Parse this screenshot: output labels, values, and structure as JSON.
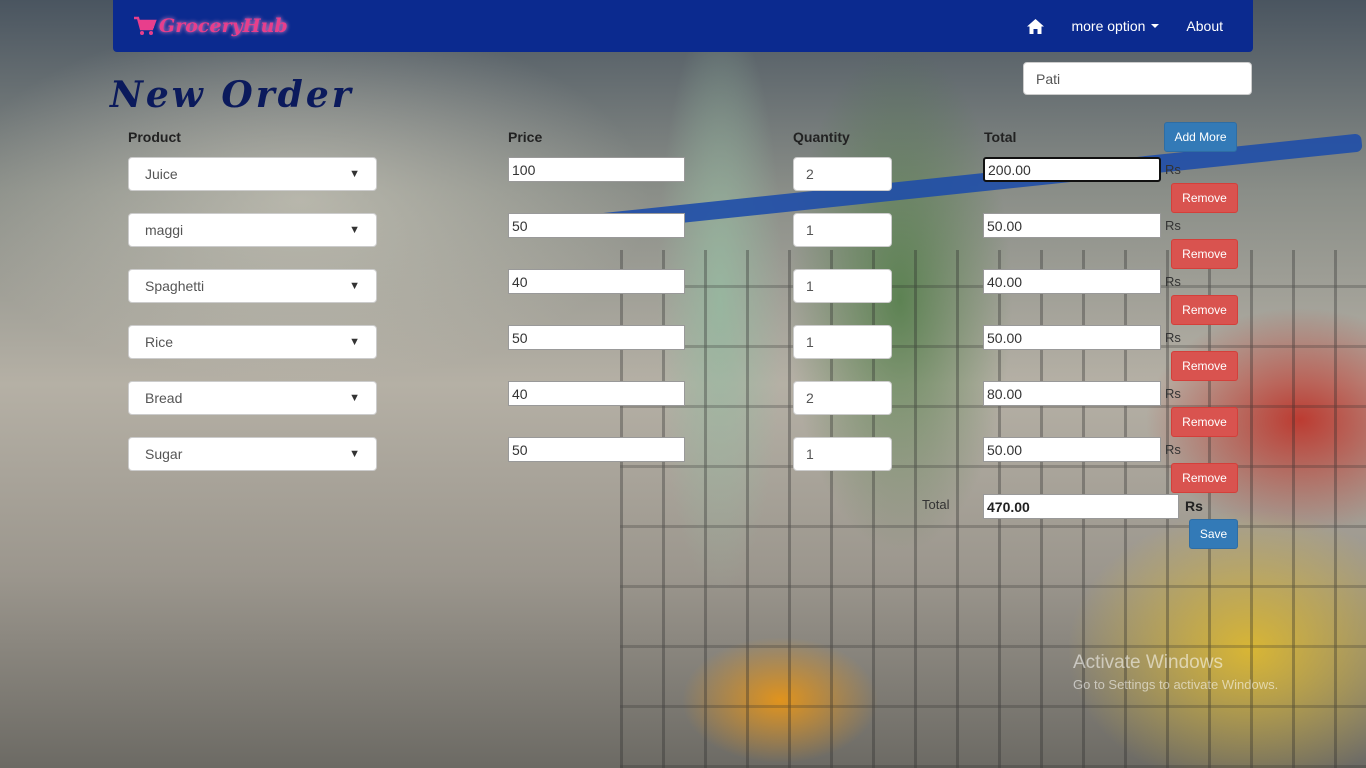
{
  "brand": {
    "name": "GroceryHub",
    "icon": "shopping-cart-icon"
  },
  "nav": {
    "home_icon": "home-icon",
    "more_option": "more option",
    "about": "About"
  },
  "search": {
    "value": "Pati"
  },
  "page": {
    "title": "New Order"
  },
  "columns": {
    "product": "Product",
    "price": "Price",
    "quantity": "Quantity",
    "total": "Total"
  },
  "buttons": {
    "add_more": "Add More",
    "remove": "Remove",
    "save": "Save"
  },
  "currency": "Rs",
  "rows": [
    {
      "product": "Juice",
      "price": "100",
      "quantity": "2",
      "total": "200.00"
    },
    {
      "product": "maggi",
      "price": "50",
      "quantity": "1",
      "total": "50.00"
    },
    {
      "product": "Spaghetti",
      "price": "40",
      "quantity": "1",
      "total": "40.00"
    },
    {
      "product": "Rice",
      "price": "50",
      "quantity": "1",
      "total": "50.00"
    },
    {
      "product": "Bread",
      "price": "40",
      "quantity": "2",
      "total": "80.00"
    },
    {
      "product": "Sugar",
      "price": "50",
      "quantity": "1",
      "total": "50.00"
    }
  ],
  "grand_total": {
    "label": "Total",
    "value": "470.00",
    "currency": "Rs"
  },
  "watermark": {
    "line1": "Activate Windows",
    "line2": "Go to Settings to activate Windows."
  },
  "colors": {
    "navbar": "#0b2a8f",
    "brand": "#e83e8c",
    "primary": "#337ab7",
    "danger": "#d9534f"
  }
}
